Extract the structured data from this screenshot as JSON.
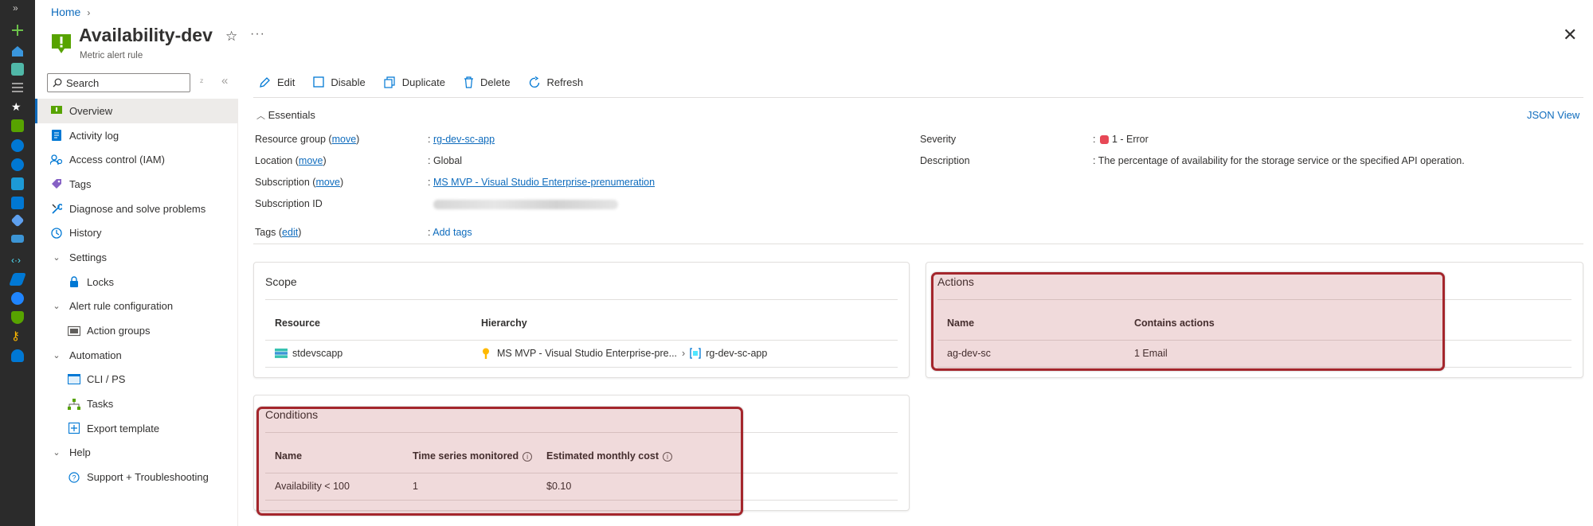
{
  "breadcrumb": {
    "home": "Home",
    "separator": "›"
  },
  "header": {
    "title": "Availability-dev",
    "subtitle": "Metric alert rule",
    "more": "···",
    "close": "✕"
  },
  "sidebar": {
    "search_placeholder": "Search",
    "items": [
      {
        "label": "Overview",
        "icon": "overview-icon"
      },
      {
        "label": "Activity log",
        "icon": "activity-log-icon"
      },
      {
        "label": "Access control (IAM)",
        "icon": "iam-icon"
      },
      {
        "label": "Tags",
        "icon": "tag-icon"
      },
      {
        "label": "Diagnose and solve problems",
        "icon": "wrench-icon"
      },
      {
        "label": "History",
        "icon": "history-icon"
      },
      {
        "label": "Settings",
        "icon": "chevron-down-icon"
      },
      {
        "label": "Locks",
        "icon": "lock-icon"
      },
      {
        "label": "Alert rule configuration",
        "icon": "chevron-down-icon"
      },
      {
        "label": "Action groups",
        "icon": "action-groups-icon"
      },
      {
        "label": "Automation",
        "icon": "chevron-down-icon"
      },
      {
        "label": "CLI / PS",
        "icon": "cli-icon"
      },
      {
        "label": "Tasks",
        "icon": "tasks-icon"
      },
      {
        "label": "Export template",
        "icon": "export-template-icon"
      },
      {
        "label": "Help",
        "icon": "chevron-down-icon"
      },
      {
        "label": "Support + Troubleshooting",
        "icon": "support-icon"
      }
    ]
  },
  "toolbar": {
    "edit": "Edit",
    "disable": "Disable",
    "duplicate": "Duplicate",
    "delete": "Delete",
    "refresh": "Refresh"
  },
  "essentials": {
    "toggle": "Essentials",
    "json_view": "JSON View",
    "move": "move",
    "edit": "edit",
    "resource_group_label": "Resource group",
    "resource_group_value": "rg-dev-sc-app",
    "location_label": "Location",
    "location_value": "Global",
    "subscription_label": "Subscription",
    "subscription_value": "MS MVP - Visual Studio Enterprise-prenumeration",
    "subscription_id_label": "Subscription ID",
    "tags_label": "Tags",
    "tags_value": "Add tags",
    "severity_label": "Severity",
    "severity_value": "1 - Error",
    "description_label": "Description",
    "description_value": "The percentage of availability for the storage service or the specified API operation."
  },
  "scope": {
    "title": "Scope",
    "col_resource": "Resource",
    "col_hierarchy": "Hierarchy",
    "resource": "stdevscapp",
    "hierarchy_subscription": "MS MVP - Visual Studio Enterprise-pre...",
    "hierarchy_resource_group": "rg-dev-sc-app"
  },
  "actions": {
    "title": "Actions",
    "col_name": "Name",
    "col_contains": "Contains actions",
    "name": "ag-dev-sc",
    "contains": "1 Email"
  },
  "conditions": {
    "title": "Conditions",
    "col_name": "Name",
    "col_time_series": "Time series monitored",
    "col_cost": "Estimated monthly cost",
    "name": "Availability < 100",
    "time_series": "1",
    "cost": "$0.10"
  },
  "colors": {
    "accent": "#0f6cbd",
    "highlight_border": "#a4262c",
    "severity": "#e74856",
    "rail": "#2b2b2b"
  }
}
